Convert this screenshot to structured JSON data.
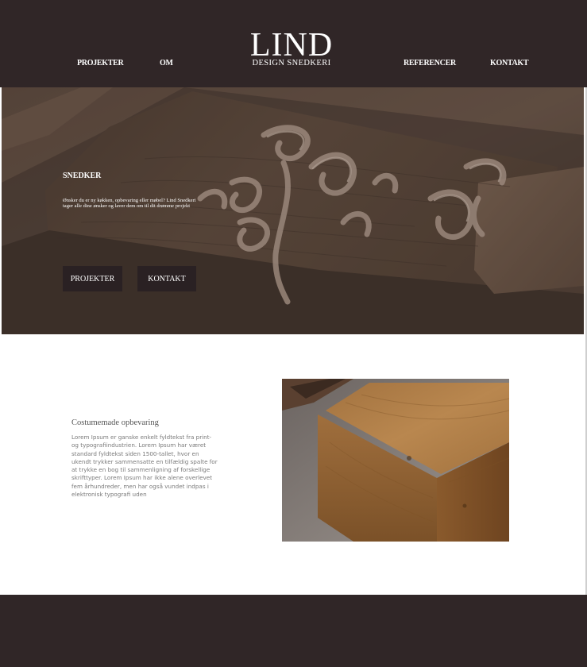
{
  "header": {
    "nav_left": [
      "PROJEKTER",
      "OM"
    ],
    "nav_right": [
      "REFERENCER",
      "KONTAKT"
    ],
    "logo_main": "LIND",
    "logo_sub": "DESIGN SNEDKERI"
  },
  "hero": {
    "title": "SNEDKER",
    "text": "Ønsker du er ny køkken, opbevaring eller møbel? Lind Snedkeri tager alle dine ønsker og laver dem om til dit drømme projekt",
    "buttons": [
      "PROJEKTER",
      "KONTAKT"
    ]
  },
  "content": {
    "heading": "Costumemade opbevaring",
    "body": "Lorem Ipsum er ganske enkelt fyldtekst fra print- og typografiindustrien. Lorem Ipsum har været standard fyldtekst siden 1500-tallet, hvor en ukendt trykker sammensatte en tilfældig spalte for at trykke en bog til sammenligning af forskellige skrifttyper. Lorem Ipsum har ikke alene overlevet fem århundreder, men har også vundet indpas i elektronisk typografi uden"
  },
  "colors": {
    "header_bg": "#302627",
    "button_bg": "#2a2123",
    "text_white": "#ffffff"
  }
}
